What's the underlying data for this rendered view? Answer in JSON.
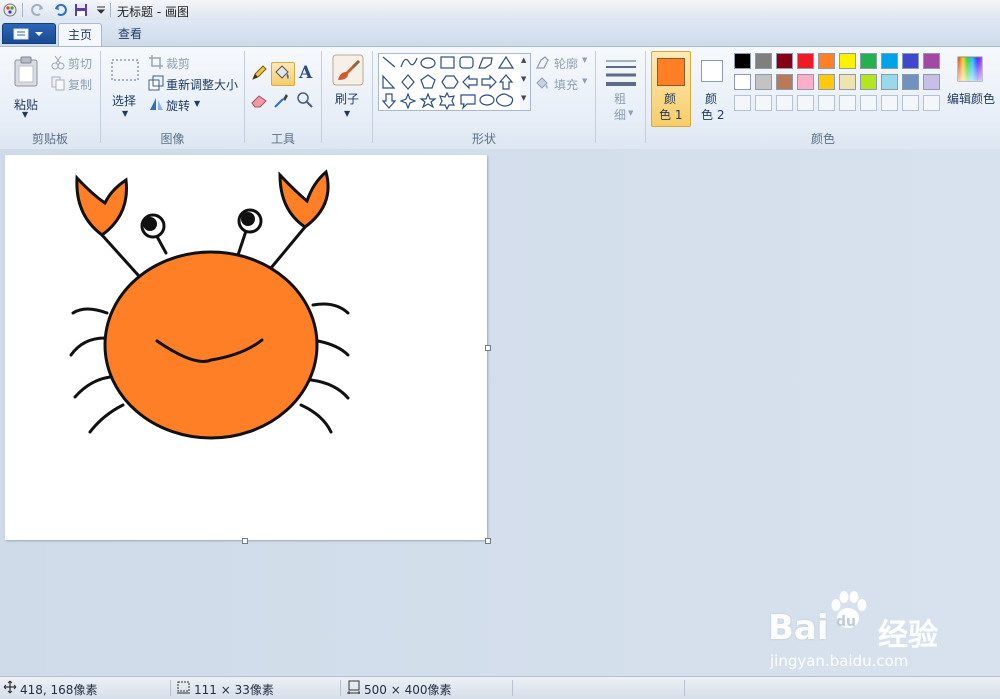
{
  "window": {
    "title": "无标题 - 画图"
  },
  "tabs": [
    {
      "label": "主页",
      "active": true
    },
    {
      "label": "查看",
      "active": false
    }
  ],
  "ribbon": {
    "clipboard": {
      "paste": "粘贴",
      "cut": "剪切",
      "copy": "复制",
      "group_label": "剪贴板"
    },
    "image": {
      "select": "选择",
      "crop": "裁剪",
      "resize": "重新调整大小",
      "rotate": "旋转",
      "group_label": "图像"
    },
    "tools": {
      "group_label": "工具",
      "text_tool": "A"
    },
    "brush": {
      "label": "刷子"
    },
    "shapes": {
      "outline": "轮廓",
      "fill": "填充",
      "group_label": "形状"
    },
    "size": {
      "line1": "粗",
      "line2": "细"
    },
    "colors": {
      "color1_line1": "颜",
      "color1_line2": "色 1",
      "color2_line1": "颜",
      "color2_line2": "色 2",
      "edit_colors": "编辑颜色",
      "group_label": "颜色",
      "color1_value": "#ff7f27",
      "color2_value": "#ffffff",
      "palette_row1": [
        "#000000",
        "#7f7f7f",
        "#880015",
        "#ed1c24",
        "#ff7f27",
        "#fff200",
        "#22b14c",
        "#00a2e8",
        "#3f48cc",
        "#a349a4"
      ],
      "palette_row2": [
        "#ffffff",
        "#c3c3c3",
        "#b97a57",
        "#ffaec9",
        "#ffc90e",
        "#efe4b0",
        "#b5e61d",
        "#99d9ea",
        "#7092be",
        "#c8bfe7"
      ]
    }
  },
  "status": {
    "cursor_pos": "418, 168像素",
    "selection_size": "111 × 33像素",
    "image_size": "500 × 400像素"
  },
  "watermark": {
    "brand": "Bai",
    "brand2": "du",
    "brand_cn": "经验",
    "url": "jingyan.baidu.com"
  }
}
